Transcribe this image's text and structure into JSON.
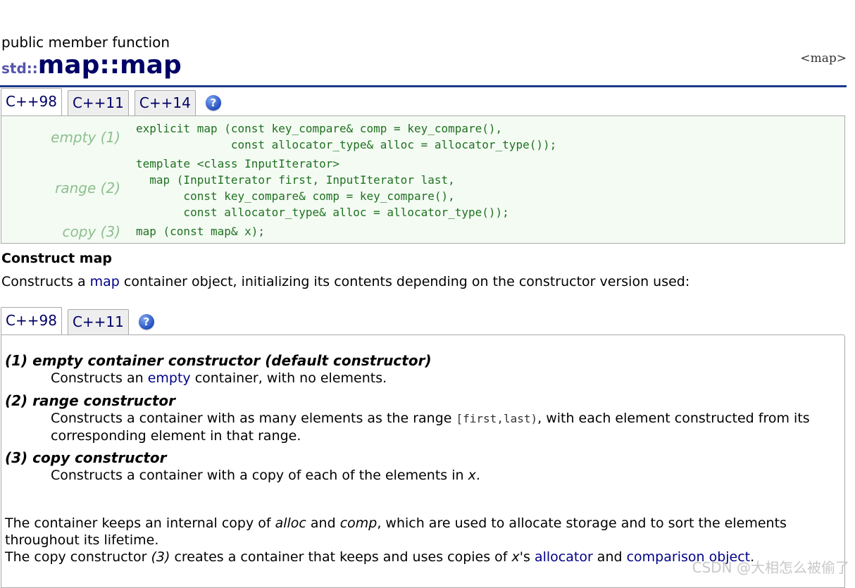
{
  "page": {
    "type_label": "public member function",
    "namespace": "std::",
    "title": "map::map",
    "header_ref": "<map>"
  },
  "tabs_top": [
    "C++98",
    "C++11",
    "C++14"
  ],
  "tabs_bottom": [
    "C++98",
    "C++11"
  ],
  "help_icon_text": "?",
  "prototypes": [
    {
      "label": "empty (1)",
      "code": "explicit map (const key_compare& comp = key_compare(),\n              const allocator_type& alloc = allocator_type());"
    },
    {
      "label": "range (2)",
      "code": "template <class InputIterator>\n  map (InputIterator first, InputIterator last,\n       const key_compare& comp = key_compare(),\n       const allocator_type& alloc = allocator_type());"
    },
    {
      "label": "copy (3)",
      "code": "map (const map& x);"
    }
  ],
  "section_title": "Construct map",
  "intro": {
    "before": "Constructs a ",
    "link": "map",
    "after": " container object, initializing its contents depending on the constructor version used:"
  },
  "descriptions": [
    {
      "title": "(1) empty container constructor (default constructor)",
      "text_before": "Constructs an ",
      "link": "empty",
      "text_after": " container, with no elements."
    },
    {
      "title": "(2) range constructor",
      "text_before": "Constructs a container with as many elements as the range ",
      "code": "[first,last)",
      "text_after": ", with each element constructed from its corresponding element in that range."
    },
    {
      "title": "(3) copy constructor",
      "text_before": "Constructs a container with a copy of each of the elements in ",
      "var": "x",
      "text_after": "."
    }
  ],
  "paragraph1": {
    "p1": "The container keeps an internal copy of ",
    "alloc": "alloc",
    "p2": " and ",
    "comp": "comp",
    "p3": ", which are used to allocate storage and to sort the elements throughout its lifetime."
  },
  "paragraph2": {
    "p1": "The copy constructor ",
    "num": "(3)",
    "p2": " creates a container that keeps and uses copies of ",
    "x": "x",
    "p3": "'s ",
    "link1": "allocator",
    "p4": " and ",
    "link2": "comparison object",
    "p5": "."
  },
  "watermark": "CSDN @大相怎么被偷了"
}
